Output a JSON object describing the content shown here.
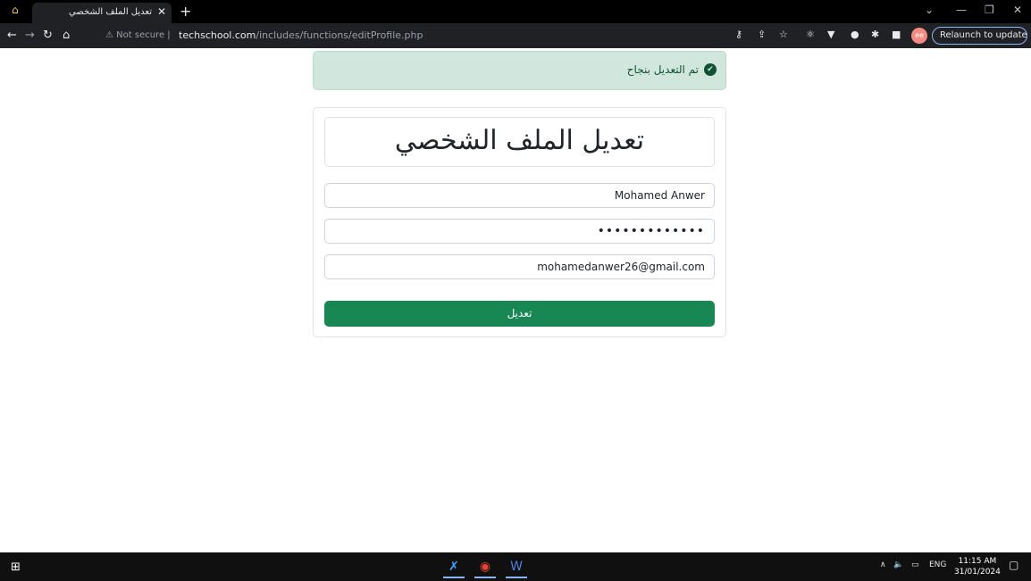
{
  "browser": {
    "tab_title": "تعديل الملف الشخصي",
    "close_glyph": "✕",
    "new_tab_glyph": "+",
    "security_label": "Not secure",
    "url_host": "techschool.com",
    "url_path": "/includes/functions/editProfile.php",
    "relaunch_label": "Relaunch to update",
    "avatar_label": "ee"
  },
  "alert": {
    "message": "تم التعديل بنجاح",
    "icon": "check-circle-icon"
  },
  "form": {
    "title": "تعديل الملف الشخصي",
    "name_value": "Mohamed Anwer",
    "password_value": "•••••••••••••",
    "email_value": "mohamedanwer26@gmail.com",
    "submit_label": "تعديل",
    "accent_color": "#198754",
    "alert_color": "#d1e7dd"
  },
  "taskbar": {
    "language": "ENG",
    "time": "11:15 AM",
    "date": "31/01/2024"
  }
}
